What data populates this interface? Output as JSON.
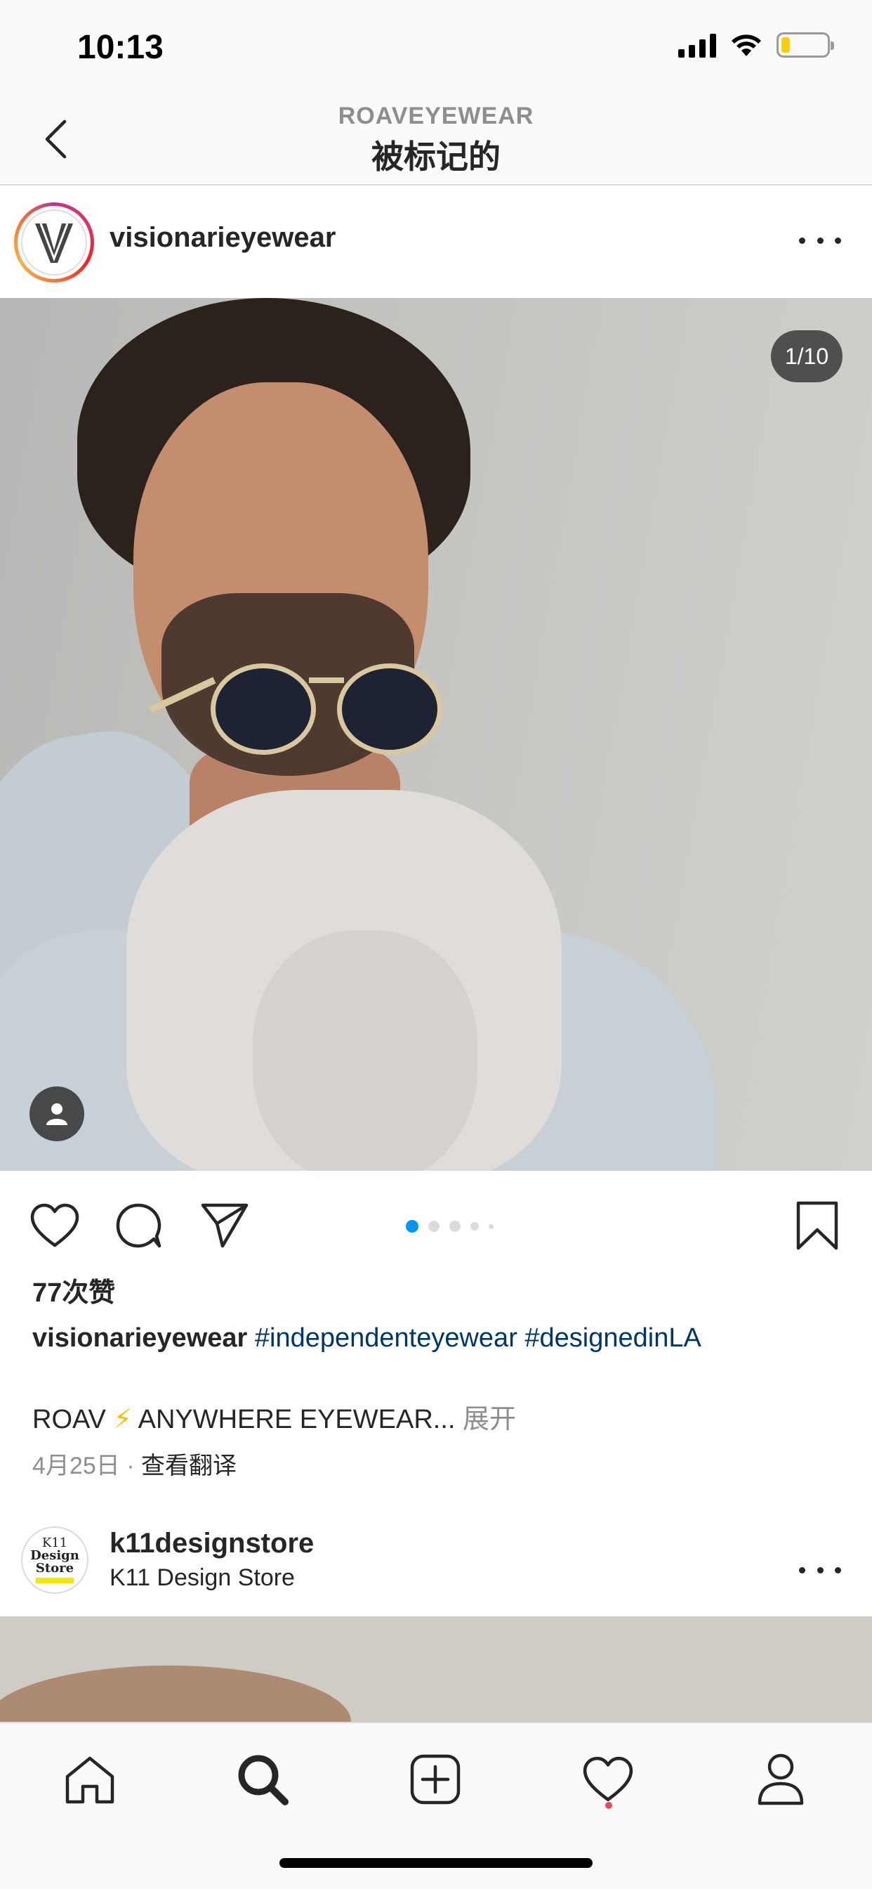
{
  "status_bar": {
    "time": "10:13",
    "battery_level": 0.2,
    "battery_color": "#ffcc00"
  },
  "header": {
    "subtitle": "ROAVEYEWEAR",
    "title": "被标记的",
    "back_icon": "chevron-left-icon"
  },
  "post": {
    "username": "visionarieyewear",
    "avatar_letter": "V",
    "image_counter": "1/10",
    "carousel": {
      "total_dots": 5,
      "active_index": 0,
      "active_color": "#0095f6"
    },
    "likes": "77次赞",
    "caption_user": "visionarieyewear",
    "caption_tags": "#independenteyewear #designedinLA",
    "caption_line2_prefix": "ROAV",
    "caption_bolt": "⚡",
    "caption_line2_rest": "ANYWHERE EYEWEAR...",
    "caption_expand": "展开",
    "date": "4月25日",
    "separator": "·",
    "translate": "查看翻译",
    "actions": [
      "heart-icon",
      "comment-icon",
      "share-icon",
      "bookmark-icon"
    ]
  },
  "post2": {
    "username": "k11designstore",
    "subtitle": "K11 Design Store",
    "avatar_lines": [
      "K11",
      "Design",
      "Store"
    ]
  },
  "tab_bar": {
    "items": [
      "home-icon",
      "search-icon",
      "add-icon",
      "activity-icon",
      "profile-icon"
    ],
    "active": "search-icon",
    "notification_color": "#ed4956"
  },
  "colors": {
    "link": "#00376b",
    "secondary_text": "#8e8e8e",
    "primary_text": "#262626"
  }
}
